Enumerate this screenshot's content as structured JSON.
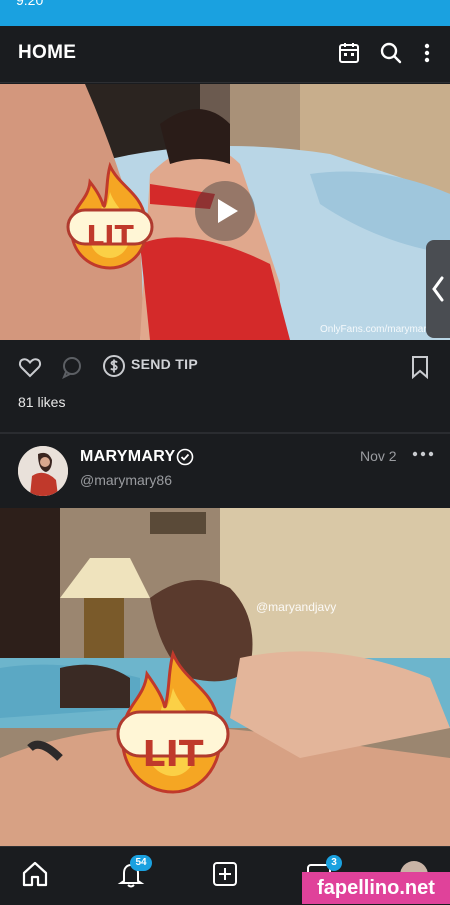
{
  "status_bar": {
    "time": "9:20"
  },
  "header": {
    "title": "HOME",
    "icons": [
      "calendar-icon",
      "search-icon",
      "more-vertical-icon"
    ]
  },
  "post1": {
    "sticker_text": "LIT",
    "video_watermark": "OnlyFans.com/marymary",
    "actions": {
      "tip_label": "SEND TIP"
    },
    "likes": "81 likes"
  },
  "post2": {
    "author": {
      "name": "MARYMARY",
      "handle": "@marymary86"
    },
    "date": "Nov 2",
    "sticker_text": "LIT",
    "video_watermark": "@maryandjavy"
  },
  "bottom_nav": {
    "items": [
      {
        "name": "home",
        "icon": "home-icon"
      },
      {
        "name": "notifications",
        "icon": "bell-icon",
        "badge": "54"
      },
      {
        "name": "create",
        "icon": "plus-square-icon"
      },
      {
        "name": "messages",
        "icon": "message-icon",
        "badge": "3"
      },
      {
        "name": "profile",
        "icon": "avatar"
      }
    ]
  },
  "site_watermark": "fapellino.net",
  "colors": {
    "accent": "#1aa1e0",
    "background": "#1a1c1f",
    "fire": "#f5a623",
    "watermark_bg": "#e0429a"
  }
}
